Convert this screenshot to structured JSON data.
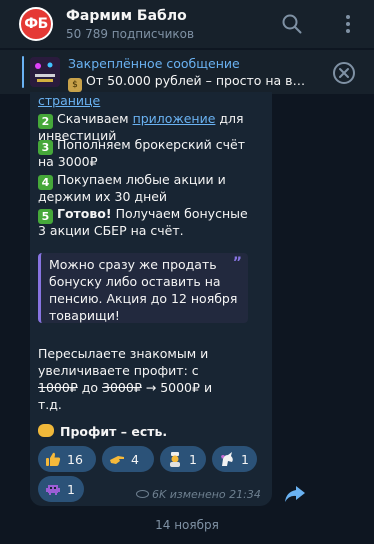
{
  "header": {
    "avatar_text": "ФБ",
    "title": "Фармим Бабло",
    "subscribers": "50 789 подписчиков",
    "search_icon": "search-icon",
    "menu_icon": "more-vertical-icon"
  },
  "pinned": {
    "title": "Закреплённое сообщение",
    "text": "От 50.000 рублей – просто на выпу…",
    "close_icon": "close-circle-icon"
  },
  "message": {
    "lines": {
      "l0": "странице",
      "l1_pre": "Скачиваем ",
      "l1_link": "приложение",
      "l1_post": " для",
      "l2": "инвестиций",
      "l3": "Пополняем брокерский счёт",
      "l4": "на 3000₽",
      "l5": "Покупаем любые акции и",
      "l6": "держим их 30 дней",
      "l7_bold": "Готово!",
      "l7_post": " Получаем бонусные",
      "l8": "3 акции СБЕР на счёт."
    },
    "steps": [
      "2",
      "3",
      "4",
      "5"
    ],
    "quote": {
      "q1": "Можно сразу же продать",
      "q2": "бонуску либо оставить на",
      "q3": "пенсию. Акция до 12 ноября",
      "q4": "товарищи!"
    },
    "p2": {
      "a": "Пересылаете знакомым и",
      "b": "увеличиваете профит: с",
      "c_strike1": "1000₽",
      "c_mid": " до ",
      "c_strike2": "3000₽",
      "c_post": " → 5000₽ и",
      "d": "т.д."
    },
    "closing": "Профит – есть.",
    "reactions": [
      {
        "emoji": "thumbs-up",
        "count": "16"
      },
      {
        "emoji": "hand-point",
        "count": "4"
      },
      {
        "emoji": "cook",
        "count": "1"
      },
      {
        "emoji": "unicorn",
        "count": "1"
      },
      {
        "emoji": "alien-monster",
        "count": "1"
      }
    ],
    "meta": "6K изменено 21:34",
    "share_icon": "share-icon"
  },
  "date_separator": "14 ноября",
  "colors": {
    "background": "#0e1621",
    "panel": "#17212b",
    "bubble": "#182533",
    "accent": "#6ab2f2",
    "reaction": "#2b5278"
  }
}
